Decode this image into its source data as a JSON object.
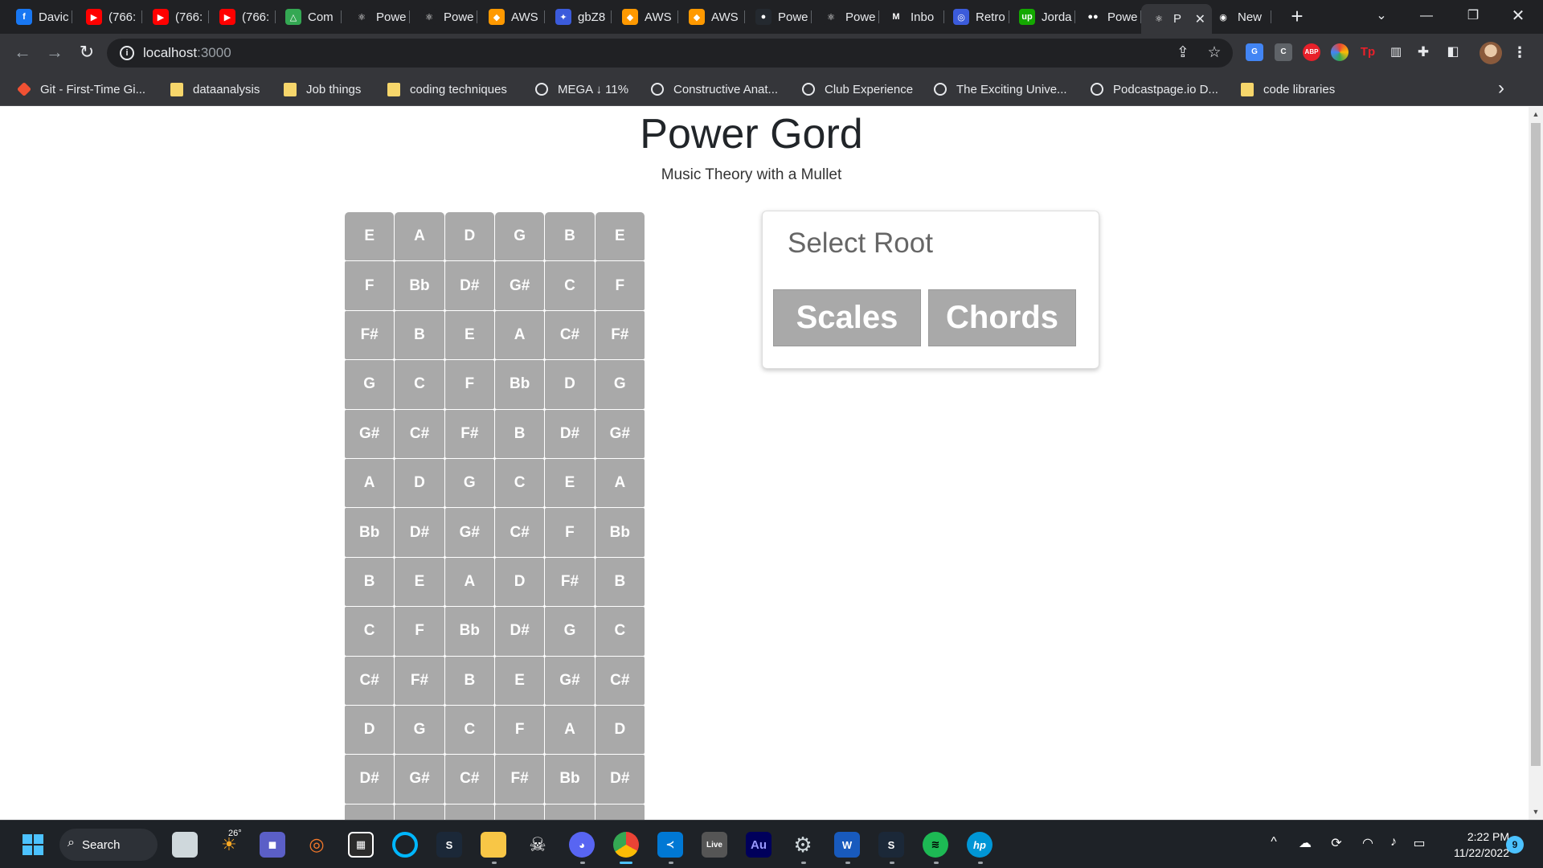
{
  "browser": {
    "tabs": [
      {
        "label": "Davic",
        "icon": "facebook-icon",
        "color": "#1877f2",
        "glyph": "f"
      },
      {
        "label": "(766:",
        "icon": "youtube-icon",
        "color": "#ff0000",
        "glyph": "▶"
      },
      {
        "label": "(766:",
        "icon": "youtube-icon",
        "color": "#ff0000",
        "glyph": "▶"
      },
      {
        "label": "(766:",
        "icon": "youtube-icon",
        "color": "#ff0000",
        "glyph": "▶"
      },
      {
        "label": "Com",
        "icon": "google-drive-icon",
        "color": "#34a853",
        "glyph": "△"
      },
      {
        "label": "Powe",
        "icon": "react-icon",
        "color": "#202124",
        "glyph": "⚛"
      },
      {
        "label": "Powe",
        "icon": "react-icon",
        "color": "#202124",
        "glyph": "⚛"
      },
      {
        "label": "AWS",
        "icon": "aws-icon",
        "color": "#ff9900",
        "glyph": "◆"
      },
      {
        "label": "gbZ8",
        "icon": "image-icon",
        "color": "#3b5bdb",
        "glyph": "✦"
      },
      {
        "label": "AWS",
        "icon": "aws-icon",
        "color": "#ff9900",
        "glyph": "◆"
      },
      {
        "label": "AWS",
        "icon": "aws-icon",
        "color": "#ff9900",
        "glyph": "◆"
      },
      {
        "label": "Powe",
        "icon": "github-icon",
        "color": "#24292f",
        "glyph": "●"
      },
      {
        "label": "Powe",
        "icon": "react-icon",
        "color": "#202124",
        "glyph": "⚛"
      },
      {
        "label": "Inbo",
        "icon": "gmail-icon",
        "color": "#202124",
        "glyph": "M"
      },
      {
        "label": "Retro",
        "icon": "retro-icon",
        "color": "#3b5bdb",
        "glyph": "◎"
      },
      {
        "label": "Jorda",
        "icon": "upwork-icon",
        "color": "#14a800",
        "glyph": "up"
      },
      {
        "label": "Powe",
        "icon": "medium-icon",
        "color": "#202124",
        "glyph": "●●"
      },
      {
        "label": "P",
        "icon": "react-icon",
        "color": "#35363a",
        "glyph": "⚛",
        "active": true
      },
      {
        "label": "New",
        "icon": "chrome-icon",
        "color": "#202124",
        "glyph": "◉"
      }
    ],
    "address": {
      "host": "localhost",
      "port": ":3000"
    },
    "bookmarks": [
      {
        "label": "Git - First-Time Gi...",
        "icon": "git-icon"
      },
      {
        "label": "dataanalysis",
        "icon": "folder-icon"
      },
      {
        "label": "Job things",
        "icon": "folder-icon"
      },
      {
        "label": "coding techniques",
        "icon": "folder-icon"
      },
      {
        "label": "MEGA ↓ 11%",
        "icon": "mega-icon"
      },
      {
        "label": "Constructive Anat...",
        "icon": "book-icon"
      },
      {
        "label": "Club Experience",
        "icon": "club-icon"
      },
      {
        "label": "The Exciting Unive...",
        "icon": "piano-icon"
      },
      {
        "label": "Podcastpage.io D...",
        "icon": "podcast-icon"
      },
      {
        "label": "code libraries",
        "icon": "folder-icon"
      }
    ],
    "extensions": [
      "translate",
      "C",
      "ABP",
      "ring",
      "Tp",
      "panel",
      "puzzle",
      "sidebar"
    ]
  },
  "page": {
    "title": "Power Gord",
    "subtitle": "Music Theory with a Mullet",
    "fretboard": [
      [
        "E",
        "A",
        "D",
        "G",
        "B",
        "E"
      ],
      [
        "F",
        "Bb",
        "D#",
        "G#",
        "C",
        "F"
      ],
      [
        "F#",
        "B",
        "E",
        "A",
        "C#",
        "F#"
      ],
      [
        "G",
        "C",
        "F",
        "Bb",
        "D",
        "G"
      ],
      [
        "G#",
        "C#",
        "F#",
        "B",
        "D#",
        "G#"
      ],
      [
        "A",
        "D",
        "G",
        "C",
        "E",
        "A"
      ],
      [
        "Bb",
        "D#",
        "G#",
        "C#",
        "F",
        "Bb"
      ],
      [
        "B",
        "E",
        "A",
        "D",
        "F#",
        "B"
      ],
      [
        "C",
        "F",
        "Bb",
        "D#",
        "G",
        "C"
      ],
      [
        "C#",
        "F#",
        "B",
        "E",
        "G#",
        "C#"
      ],
      [
        "D",
        "G",
        "C",
        "F",
        "A",
        "D"
      ],
      [
        "D#",
        "G#",
        "C#",
        "F#",
        "Bb",
        "D#"
      ],
      [
        "",
        "",
        "",
        "",
        "",
        ""
      ]
    ],
    "root_card": {
      "heading": "Select Root",
      "scales_label": "Scales",
      "chords_label": "Chords"
    }
  },
  "taskbar": {
    "search_label": "Search",
    "weather_temp": "26°",
    "time": "2:22 PM",
    "date": "11/22/2022",
    "notifications": "9"
  }
}
